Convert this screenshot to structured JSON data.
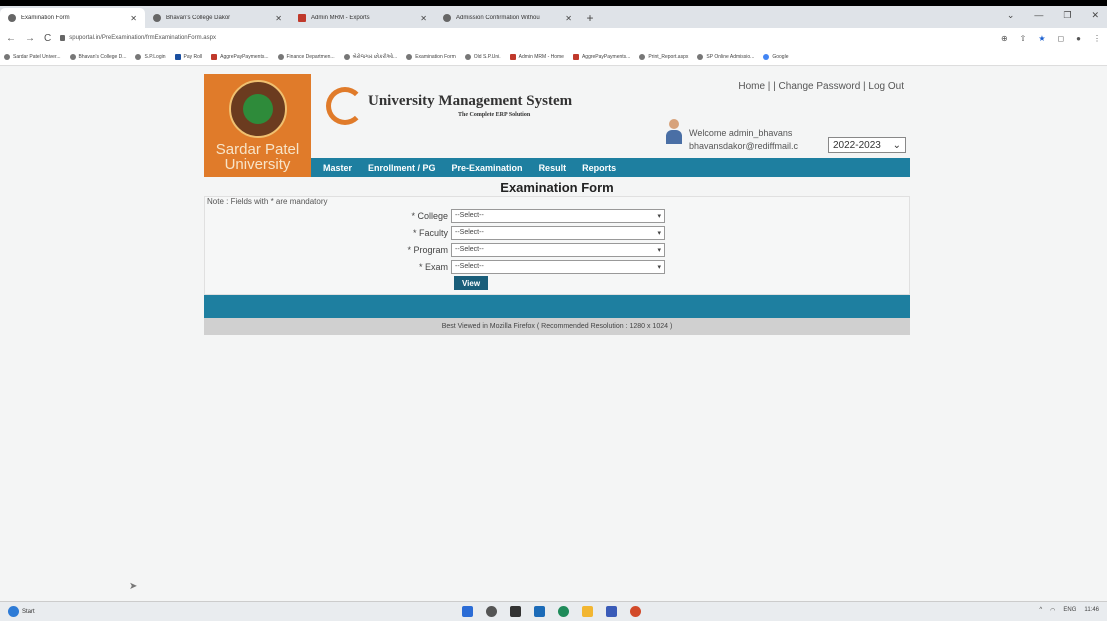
{
  "browser": {
    "tabs": [
      {
        "label": "Examination Form",
        "icon": "globe-icon"
      },
      {
        "label": "Bhavan's College Dakor",
        "icon": "college-icon"
      },
      {
        "label": "Admin MRM - Exports",
        "icon": "mrm-icon"
      },
      {
        "label": "Admission Confirmation Withou",
        "icon": "globe-icon"
      }
    ],
    "new_tab": "+",
    "url": "spuportal.in/PreExamination/frmExaminationForm.aspx",
    "bookmarks": [
      "Sardar Patel Univer...",
      "Bhavan's College D...",
      "S.P.Login",
      "Pay Roll",
      "AggrePayPayments...",
      "Finance Departmen...",
      "બેરોજગાર છોકરીઓ...",
      "Examination Form",
      "Old S.P.Uni.",
      "Admin MRM - Home",
      "AggrePayPayments...",
      "Print_Report.aspx",
      "SP Online Admissio...",
      "Google"
    ]
  },
  "header": {
    "university_name": "Sardar Patel University",
    "system_title": "University Management System",
    "system_subtitle": "The Complete ERP Solution",
    "links": "Home | | Change Password | Log Out",
    "welcome": "Welcome admin_bhavans",
    "email": "bhavansdakor@rediffmail.c",
    "year": "2022-2023"
  },
  "nav": [
    "Master",
    "Enrollment / PG",
    "Pre-Examination",
    "Result",
    "Reports"
  ],
  "form": {
    "title": "Examination Form",
    "note": "Note : Fields with * are mandatory",
    "fields": [
      {
        "label": "* College",
        "value": "--Select--"
      },
      {
        "label": "* Faculty",
        "value": "--Select--"
      },
      {
        "label": "* Program",
        "value": "--Select--"
      },
      {
        "label": "* Exam",
        "value": "--Select--"
      }
    ],
    "view_button": "View"
  },
  "footer": {
    "note": "Best Viewed in Mozilla Firefox  ( Recommended Resolution : 1280 x 1024 )"
  },
  "taskbar": {
    "start": "Start",
    "lang": "ENG",
    "time": "11:46"
  },
  "colors": {
    "nav_bg": "#1e7fa0",
    "logo_bg": "#e07b2a",
    "button_bg": "#1a5e7a"
  }
}
